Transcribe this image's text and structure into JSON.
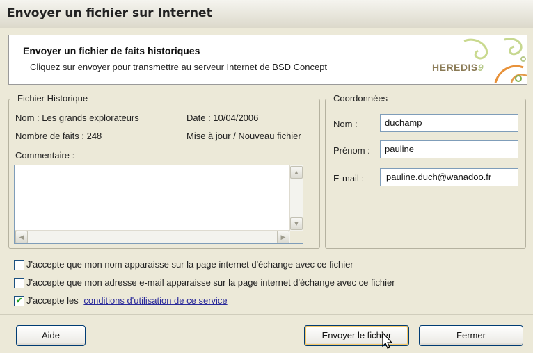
{
  "window": {
    "title": "Envoyer un fichier sur Internet"
  },
  "header": {
    "title": "Envoyer un fichier de faits historiques",
    "subtitle": "Cliquez sur envoyer pour transmettre au serveur Internet de BSD Concept",
    "logo_text": "HEREDIS",
    "logo_number": "9"
  },
  "fichier": {
    "legend": "Fichier Historique",
    "nom": "Nom : Les grands explorateurs",
    "date": "Date : 10/04/2006",
    "nombre": "Nombre de faits : 248",
    "mise_a_jour": "Mise à jour / Nouveau fichier",
    "commentaire_label": "Commentaire :",
    "commentaire_value": ""
  },
  "coordonnees": {
    "legend": "Coordonnées",
    "nom_label": "Nom :",
    "nom_value": "duchamp",
    "prenom_label": "Prénom :",
    "prenom_value": "pauline",
    "email_label": "E-mail :",
    "email_value": "pauline.duch@wanadoo.fr"
  },
  "checkboxes": [
    {
      "label": "J'accepte que mon nom apparaisse sur la page internet d'échange avec ce fichier",
      "checked": false
    },
    {
      "label": "J'accepte que mon adresse e-mail apparaisse sur la page internet d'échange avec ce fichier",
      "checked": false
    },
    {
      "label": "J'accepte les",
      "link": "conditions d'utilisation de ce service",
      "checked": true
    }
  ],
  "buttons": {
    "aide": "Aide",
    "envoyer": "Envoyer le fichier",
    "fermer": "Fermer"
  },
  "icons": {
    "scroll_up": "▲",
    "scroll_down": "▼",
    "scroll_left": "◀",
    "scroll_right": "▶",
    "check": "✔"
  }
}
